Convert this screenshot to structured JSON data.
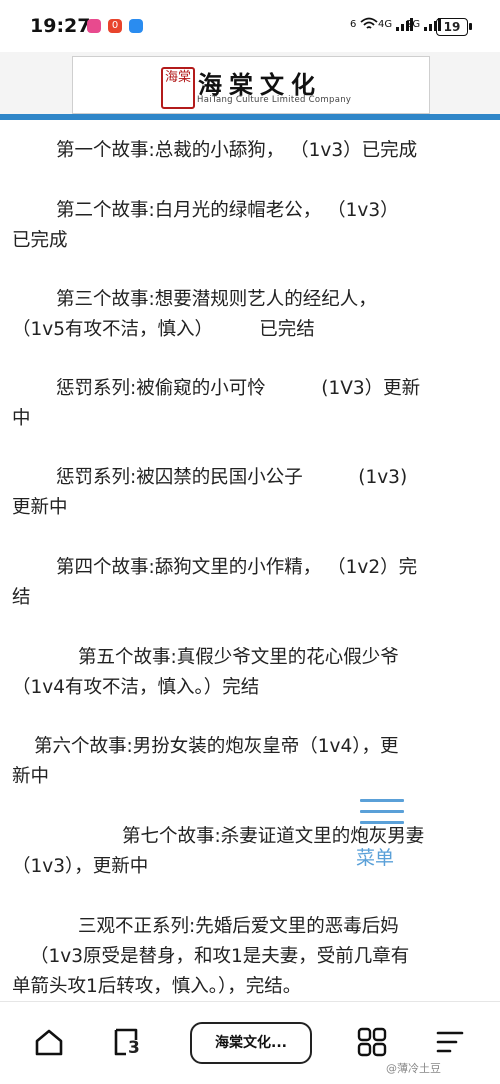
{
  "status_bar": {
    "time": "19:27",
    "notification_badge": "0",
    "signal_1": "6",
    "signal_2": "4G",
    "signal_3": "2G",
    "battery": "19"
  },
  "header": {
    "seal_text": "海棠",
    "logo_title": "海棠文化",
    "logo_subtitle": "HaiTang Culture Limited Company"
  },
  "stories": [
    {
      "text": "第一个故事:总裁的小舔狗， （1v3）已完成",
      "indent": 56
    },
    {
      "text": "第二个故事:白月光的绿帽老公， （1v3）",
      "line2": "已完成",
      "indent": 56
    },
    {
      "text": "第三个故事:想要潜规则艺人的经纪人，",
      "line2": "（1v5有攻不洁，慎入）　　　已完结",
      "indent": 56
    },
    {
      "text": "惩罚系列:被偷窥的小可怜　　　(1V3）更新",
      "line2": "中",
      "indent": 56
    },
    {
      "text": "惩罚系列:被囚禁的民国小公子　　　(1v3)",
      "line2": "更新中",
      "indent": 56
    },
    {
      "text": "第四个故事:舔狗文里的小作精， （1v2）完",
      "line2": "结",
      "indent": 56
    },
    {
      "text": "第五个故事:真假少爷文里的花心假少爷",
      "line2": "（1v4有攻不洁，慎入。）完结",
      "indent": 78
    },
    {
      "text": "第六个故事:男扮女装的炮灰皇帝（1v4），更",
      "line2": "新中",
      "indent": 34
    },
    {
      "text": "第七个故事:杀妻证道文里的炮灰男妻",
      "line2": "（1v3），更新中",
      "indent": 122
    },
    {
      "text": "三观不正系列:先婚后爱文里的恶毒后妈",
      "line2": "（1v3原受是替身，和攻1是夫妻，受前几章有",
      "line3": "单箭头攻1后转攻，慎入。），完结。",
      "indent": 78
    }
  ],
  "float_menu": {
    "label": "菜单"
  },
  "bottom_nav": {
    "tab_count": "3",
    "current_tab": "海棠文化...",
    "watermark": "@薄冷土豆"
  },
  "colors": {
    "accent": "#2f86c8",
    "menu": "#5aa0d8",
    "seal": "#b31b1b"
  }
}
